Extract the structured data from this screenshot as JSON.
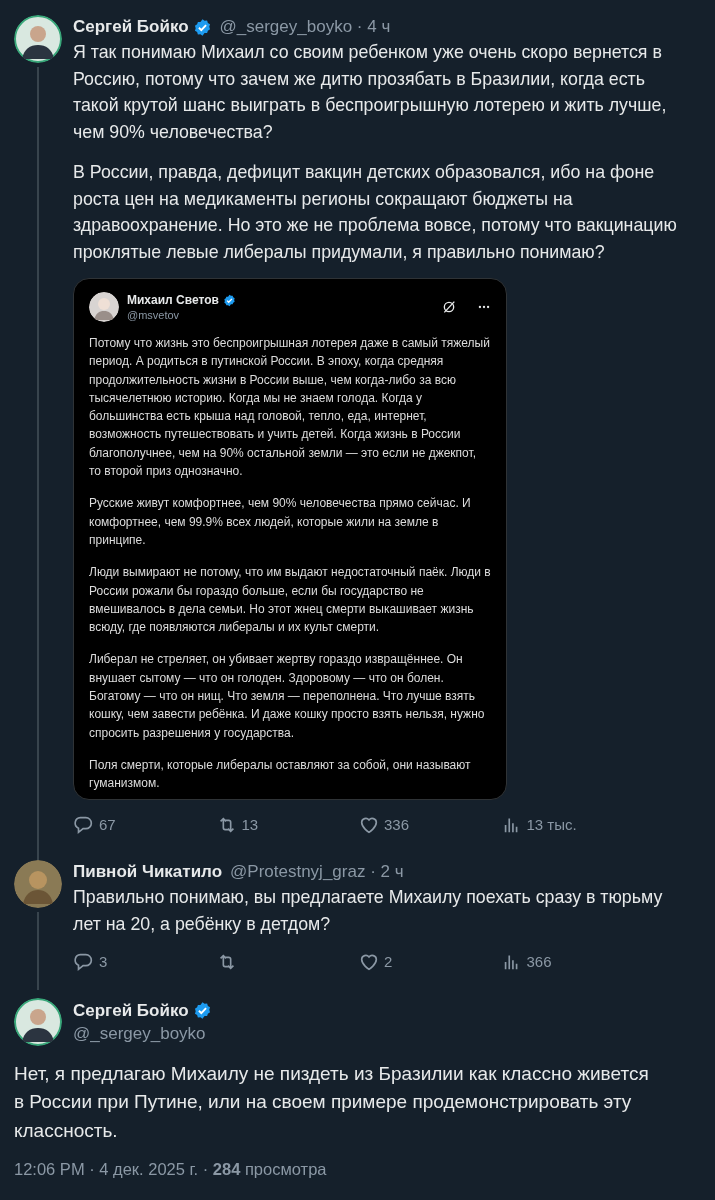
{
  "post": {
    "author": "Сергей Бойко",
    "verified": true,
    "meta": "@_sergey_boyko · 4 ч",
    "paragraphs": [
      "Я так понимаю Михаил со своим ребенком уже очень скоро вернется в Россию, потому что зачем же дитю прозябать в Бразилии, когда есть такой крутой шанс выиграть в беспроигрышную лотерею и жить лучше, чем 90% человечества?",
      "В России, правда, дефицит вакцин детских образовался, ибо на фоне роста цен на медикаменты регионы сокращают бюджеты на здравоохранение. Но это же не проблема вовсе, потому что вакцинацию проклятые левые либералы придумали, я правильно понимаю?"
    ],
    "quote": {
      "author": "Михаил Светов",
      "verified": true,
      "handle": "@msvetov",
      "paragraphs": [
        "Потому что жизнь это беспроигрышная лотерея даже в самый тяжелый период. А родиться в путинской России. В эпоху, когда средняя продолжительность жизни в России выше, чем когда-либо за всю тысячелетнюю историю. Когда мы не знаем голода. Когда у большинства есть крыша над головой, тепло, еда, интернет, возможность путешествовать и учить детей. Когда жизнь в России благополучнее, чем на 90% остальной земли — это если не джекпот, то второй приз однозначно.",
        "Русские живут комфортнее, чем 90% человечества прямо сейчас. И комфортнее, чем 99.9% всех людей, которые жили на земле в принципе.",
        "Люди вымирают не потому, что им выдают недостаточный паёк. Люди в России рожали бы гораздо больше, если бы государство не вмешивалось в дела семьи. Но этот жнец смерти выкашивает жизнь всюду, где появляются либералы и их культ смерти.",
        "Либерал не стреляет, он убивает жертву гораздо извращённее. Он внушает сытому — что он голоден. Здоровому — что он болен. Богатому — что он нищ. Что земля — переполнена. Что лучше взять кошку, чем завести ребёнка. И даже кошку просто взять нельзя, нужно спросить разрешения у государства.",
        "Поля смерти, которые либералы оставляют за собой, они называют гуманизмом."
      ]
    },
    "actions": [
      {
        "kind": "reply",
        "count": "67"
      },
      {
        "kind": "repost",
        "count": "13"
      },
      {
        "kind": "like",
        "count": "336"
      },
      {
        "kind": "views",
        "count": "13 тыс."
      }
    ]
  },
  "reply": {
    "author": "Пивной Чикатило",
    "verified": false,
    "meta": "@Protestnyj_graz · 2 ч",
    "paragraphs": [
      "Правильно понимаю, вы предлагаете Михаилу поехать сразу в тюрьму лет на 20, а ребёнку в детдом?"
    ],
    "actions": [
      {
        "kind": "reply",
        "count": "3"
      },
      {
        "kind": "repost"
      },
      {
        "kind": "like",
        "count": "2"
      },
      {
        "kind": "views",
        "count": "366"
      }
    ]
  },
  "focused_post": {
    "author": "Сергей Бойко",
    "verified": true,
    "handle": "@_sergey_boyko",
    "paragraphs": [
      "Нет, я предлагаю Михаилу не пиздеть из Бразилии как классно живется в России при Путине, или на своем примере продемонстрировать эту классность."
    ],
    "footer": "12:06 PM · 4 дек. 2025 г. · **284** просмотра"
  }
}
